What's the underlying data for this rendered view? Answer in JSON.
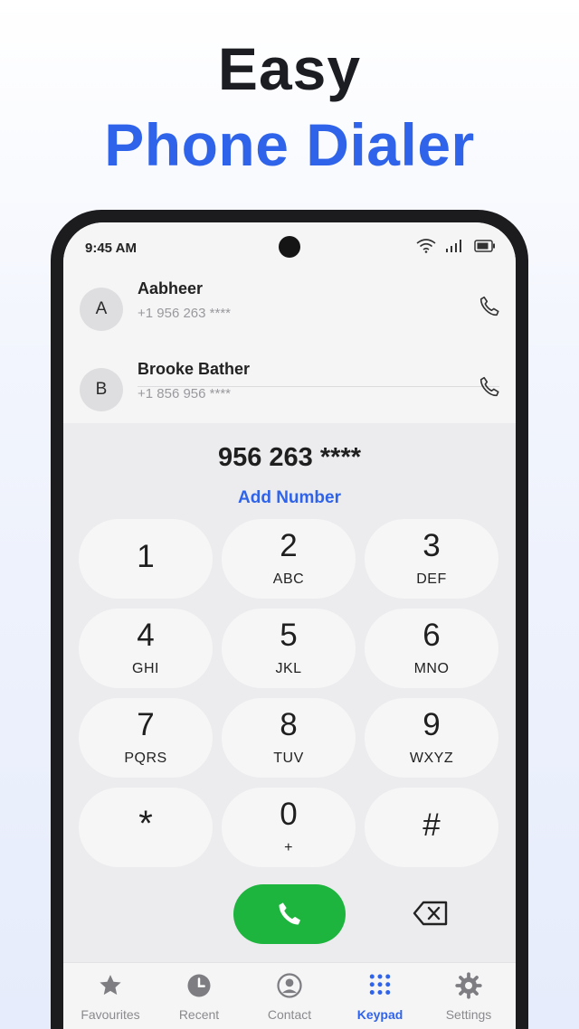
{
  "promo": {
    "line1": "Easy",
    "line2": "Phone Dialer"
  },
  "status_bar": {
    "time": "9:45 AM"
  },
  "contacts": [
    {
      "initial": "A",
      "name": "Aabheer",
      "number": "+1 956 263 ****"
    },
    {
      "initial": "B",
      "name": "Brooke Bather",
      "number": "+1 856 956 ****"
    }
  ],
  "dialer": {
    "number": "956 263 ****",
    "add_number_label": "Add Number",
    "keys": [
      {
        "digit": "1",
        "letters": ""
      },
      {
        "digit": "2",
        "letters": "ABC"
      },
      {
        "digit": "3",
        "letters": "DEF"
      },
      {
        "digit": "4",
        "letters": "GHI"
      },
      {
        "digit": "5",
        "letters": "JKL"
      },
      {
        "digit": "6",
        "letters": "MNO"
      },
      {
        "digit": "7",
        "letters": "PQRS"
      },
      {
        "digit": "8",
        "letters": "TUV"
      },
      {
        "digit": "9",
        "letters": "WXYZ"
      },
      {
        "digit": "*",
        "letters": ""
      },
      {
        "digit": "0",
        "letters": "+"
      },
      {
        "digit": "#",
        "letters": ""
      }
    ]
  },
  "bottom_nav": {
    "items": [
      {
        "label": "Favourites",
        "icon": "star-icon"
      },
      {
        "label": "Recent",
        "icon": "clock-icon"
      },
      {
        "label": "Contact",
        "icon": "person-icon"
      },
      {
        "label": "Keypad",
        "icon": "keypad-icon"
      },
      {
        "label": "Settings",
        "icon": "gear-icon"
      }
    ],
    "active": "Keypad"
  },
  "colors": {
    "accent": "#2f63ea",
    "call_green": "#1db53e",
    "headline_dark": "#1b1d22"
  }
}
